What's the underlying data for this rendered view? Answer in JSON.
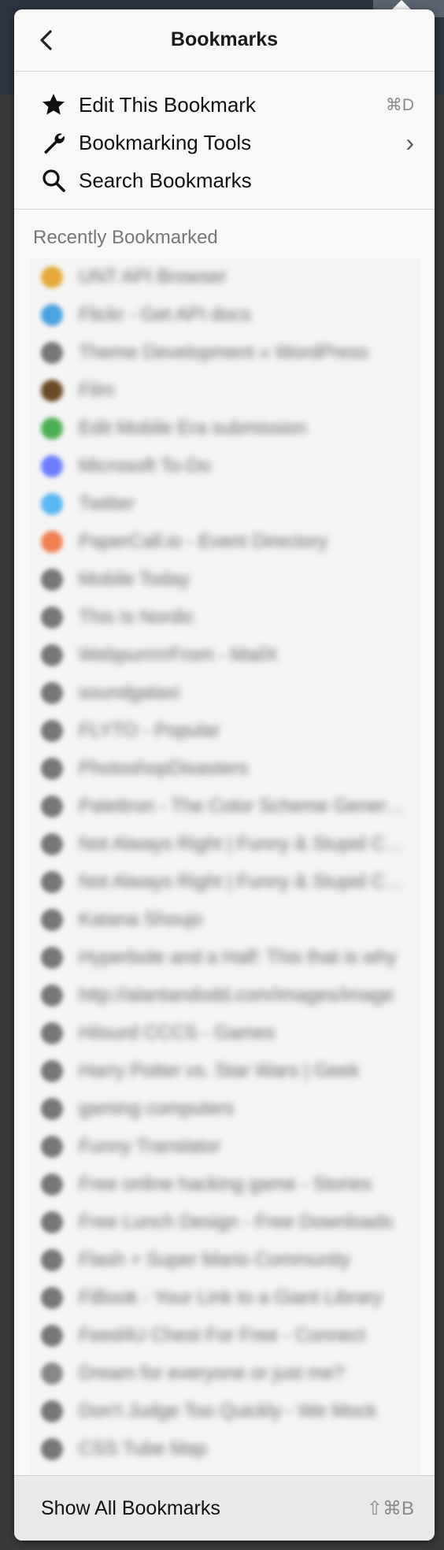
{
  "header": {
    "title": "Bookmarks"
  },
  "menu": [
    {
      "name": "edit-bookmark",
      "icon": "star-icon",
      "label": "Edit This Bookmark",
      "shortcut": "⌘D"
    },
    {
      "name": "bookmarking-tools",
      "icon": "wrench-icon",
      "label": "Bookmarking Tools",
      "shortcut": "›"
    },
    {
      "name": "search-bookmarks",
      "icon": "search-icon",
      "label": "Search Bookmarks",
      "shortcut": ""
    }
  ],
  "recent": {
    "label": "Recently Bookmarked",
    "items": [
      {
        "title": "UNT API Browser",
        "favicon": "#e6a93a"
      },
      {
        "title": "Flickr - Get API docs",
        "favicon": "#4aa3df"
      },
      {
        "title": "Theme Development « WordPress",
        "favicon": "#777777"
      },
      {
        "title": "Film",
        "favicon": "#6a4a24"
      },
      {
        "title": "Edit Mobile Era submission",
        "favicon": "#4caf50"
      },
      {
        "title": "Microsoft To-Do",
        "favicon": "#6b7cff"
      },
      {
        "title": "Twitter",
        "favicon": "#59b7f2"
      },
      {
        "title": "PaperCall.io - Event Directory",
        "favicon": "#f08050"
      },
      {
        "title": "Mobile Today",
        "favicon": "#777777"
      },
      {
        "title": "This Is Nordic",
        "favicon": "#777777"
      },
      {
        "title": "WebpurrrrrFrom - MailX",
        "favicon": "#777777"
      },
      {
        "title": "soundgalaxi",
        "favicon": "#777777"
      },
      {
        "title": "FLYTO - Popular",
        "favicon": "#777777"
      },
      {
        "title": "PhotoshopDisasters",
        "favicon": "#777777"
      },
      {
        "title": "Palettron - The Color Scheme Generator",
        "favicon": "#777777"
      },
      {
        "title": "Not Always Right | Funny & Stupid Customer",
        "favicon": "#777777"
      },
      {
        "title": "Not Always Right | Funny & Stupid Customer",
        "favicon": "#777777"
      },
      {
        "title": "Katana Shoujo",
        "favicon": "#777777"
      },
      {
        "title": "Hyperbole and a Half: This that is why",
        "favicon": "#777777"
      },
      {
        "title": "http://alantandodd.com/images/image",
        "favicon": "#777777"
      },
      {
        "title": "Hitsurd CCCS - Games",
        "favicon": "#777777"
      },
      {
        "title": "Harry Potter vs. Star Wars | Geek",
        "favicon": "#777777"
      },
      {
        "title": "gaming computers",
        "favicon": "#777777"
      },
      {
        "title": "Funny Translator",
        "favicon": "#777777"
      },
      {
        "title": "Free online hacking game - Stories",
        "favicon": "#777777"
      },
      {
        "title": "Free Lunch Design - Free Downloads",
        "favicon": "#777777"
      },
      {
        "title": "Flash + Super Mario Community",
        "favicon": "#777777"
      },
      {
        "title": "FiBook - Your Link to a Giant Library",
        "favicon": "#777777"
      },
      {
        "title": "Feed4U Chest For Free - Connect",
        "favicon": "#777777"
      },
      {
        "title": "Dream for everyone or just me?",
        "favicon": "#888888"
      },
      {
        "title": "Don't Judge Too Quickly - We Mock",
        "favicon": "#777777"
      },
      {
        "title": "CSS Tube Map",
        "favicon": "#777777"
      }
    ]
  },
  "footer": {
    "label": "Show All Bookmarks",
    "shortcut": "⇧⌘B"
  }
}
